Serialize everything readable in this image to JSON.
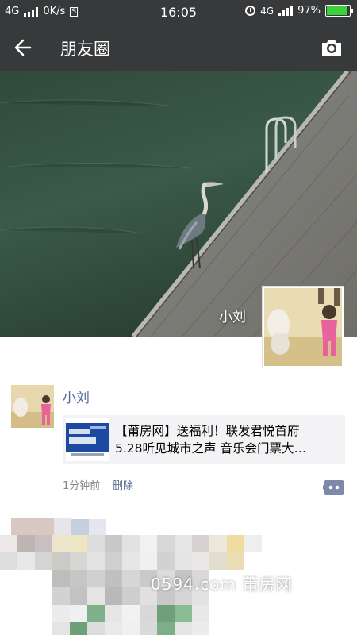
{
  "status_bar": {
    "network_type": "4G",
    "speed": "0K/s",
    "sim_badge": "S",
    "time": "16:05",
    "network_type_right": "4G",
    "battery": "97%",
    "battery_level": 0.97
  },
  "title_bar": {
    "title": "朋友圈",
    "back_icon": "arrow-left-icon",
    "camera_icon": "camera-icon"
  },
  "cover": {
    "user_name": "小刘"
  },
  "posts": [
    {
      "author": "小刘",
      "link_title_line1": "【莆房网】送福利！联发君悦首府",
      "link_title_line2": "5.28听见城市之声 音乐会门票大…",
      "time": "1分钟前",
      "delete_label": "删除",
      "comment_icon": "comment-icon"
    }
  ],
  "watermark": "0594.com 莆房网",
  "colors": {
    "header_bg": "#37393b",
    "name_link": "#576b95",
    "battery_fill": "#3cd13c"
  }
}
